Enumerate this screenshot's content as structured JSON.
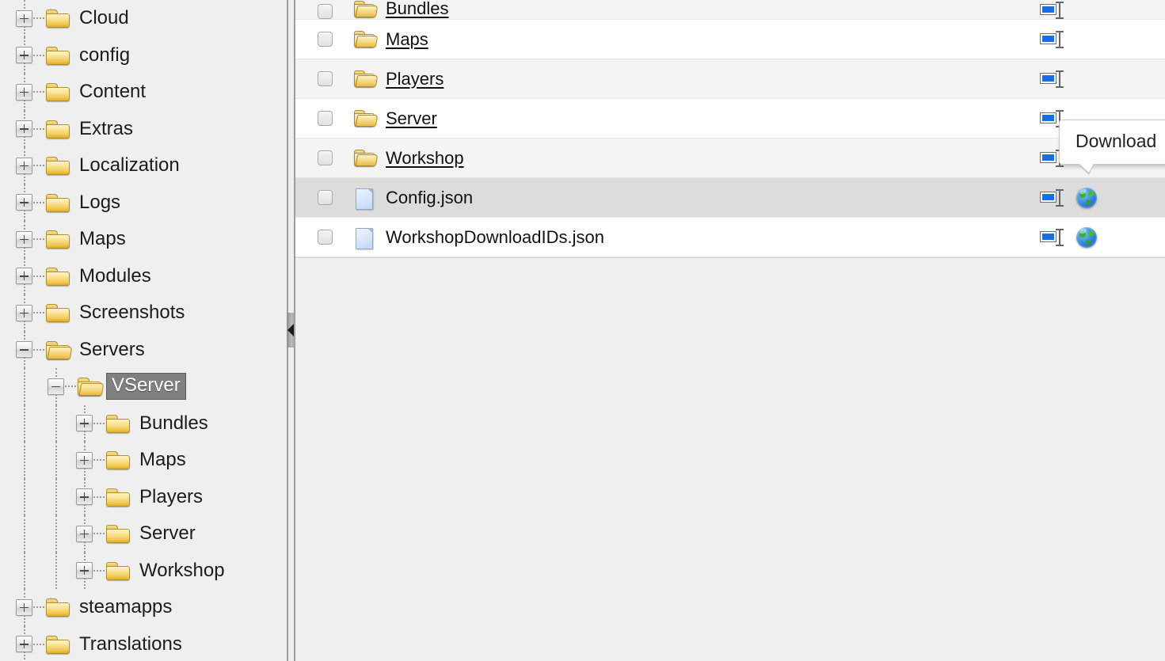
{
  "tree": {
    "nodes": [
      {
        "label": "Cloud",
        "depth": 0,
        "state": "collapsed",
        "icon": "folder-closed-icon",
        "selected": false
      },
      {
        "label": "config",
        "depth": 0,
        "state": "collapsed",
        "icon": "folder-closed-icon",
        "selected": false
      },
      {
        "label": "Content",
        "depth": 0,
        "state": "collapsed",
        "icon": "folder-closed-icon",
        "selected": false
      },
      {
        "label": "Extras",
        "depth": 0,
        "state": "collapsed",
        "icon": "folder-closed-icon",
        "selected": false
      },
      {
        "label": "Localization",
        "depth": 0,
        "state": "collapsed",
        "icon": "folder-closed-icon",
        "selected": false
      },
      {
        "label": "Logs",
        "depth": 0,
        "state": "collapsed",
        "icon": "folder-closed-icon",
        "selected": false
      },
      {
        "label": "Maps",
        "depth": 0,
        "state": "collapsed",
        "icon": "folder-closed-icon",
        "selected": false
      },
      {
        "label": "Modules",
        "depth": 0,
        "state": "collapsed",
        "icon": "folder-closed-icon",
        "selected": false
      },
      {
        "label": "Screenshots",
        "depth": 0,
        "state": "collapsed",
        "icon": "folder-closed-icon",
        "selected": false
      },
      {
        "label": "Servers",
        "depth": 0,
        "state": "expanded",
        "icon": "folder-open-icon",
        "selected": false
      },
      {
        "label": "VServer",
        "depth": 1,
        "state": "expanded",
        "icon": "folder-open-icon",
        "selected": true
      },
      {
        "label": "Bundles",
        "depth": 2,
        "state": "collapsed",
        "icon": "folder-closed-icon",
        "selected": false
      },
      {
        "label": "Maps",
        "depth": 2,
        "state": "collapsed",
        "icon": "folder-closed-icon",
        "selected": false
      },
      {
        "label": "Players",
        "depth": 2,
        "state": "collapsed",
        "icon": "folder-closed-icon",
        "selected": false
      },
      {
        "label": "Server",
        "depth": 2,
        "state": "collapsed",
        "icon": "folder-closed-icon",
        "selected": false
      },
      {
        "label": "Workshop",
        "depth": 2,
        "state": "collapsed",
        "icon": "folder-closed-icon",
        "selected": false
      },
      {
        "label": "steamapps",
        "depth": 0,
        "state": "collapsed",
        "icon": "folder-closed-icon",
        "selected": false
      },
      {
        "label": "Translations",
        "depth": 0,
        "state": "collapsed",
        "icon": "folder-closed-icon",
        "selected": false
      }
    ]
  },
  "splitter": {
    "handle_icon": "collapse-left-arrow-icon"
  },
  "file_list": {
    "rows": [
      {
        "name": "Bundles",
        "type": "folder",
        "icon": "folder-open-icon",
        "link": true,
        "checked": false,
        "clipped": true,
        "stripe": "alt",
        "hover": false,
        "actions": [
          "rename-icon"
        ]
      },
      {
        "name": "Maps",
        "type": "folder",
        "icon": "folder-open-icon",
        "link": true,
        "checked": false,
        "clipped": false,
        "stripe": "plain",
        "hover": false,
        "actions": [
          "rename-icon"
        ]
      },
      {
        "name": "Players",
        "type": "folder",
        "icon": "folder-open-icon",
        "link": true,
        "checked": false,
        "clipped": false,
        "stripe": "alt",
        "hover": false,
        "actions": [
          "rename-icon"
        ]
      },
      {
        "name": "Server",
        "type": "folder",
        "icon": "folder-open-icon",
        "link": true,
        "checked": false,
        "clipped": false,
        "stripe": "plain",
        "hover": false,
        "actions": [
          "rename-icon"
        ]
      },
      {
        "name": "Workshop",
        "type": "folder",
        "icon": "folder-open-icon",
        "link": true,
        "checked": false,
        "clipped": false,
        "stripe": "alt",
        "hover": false,
        "actions": [
          "rename-icon"
        ]
      },
      {
        "name": "Config.json",
        "type": "file",
        "icon": "file-document-icon",
        "link": false,
        "checked": false,
        "clipped": false,
        "stripe": "plain",
        "hover": true,
        "actions": [
          "rename-icon",
          "globe-icon"
        ]
      },
      {
        "name": "WorkshopDownloadIDs.json",
        "type": "file",
        "icon": "file-document-icon",
        "link": false,
        "checked": false,
        "clipped": false,
        "stripe": "plain",
        "hover": false,
        "actions": [
          "rename-icon",
          "globe-icon"
        ]
      }
    ]
  },
  "tooltip": {
    "text": "Download",
    "visible": true
  },
  "colors": {
    "panel_background": "#efefef",
    "row_background": "#ffffff",
    "row_stripe": "#f4f4f4",
    "row_hover": "#dcdcdc",
    "selection": "#808080",
    "folder_yellow": "#f0c64f",
    "link_text": "#111111",
    "accent_blue": "#1a6fe0",
    "globe_green": "#3fae32"
  }
}
